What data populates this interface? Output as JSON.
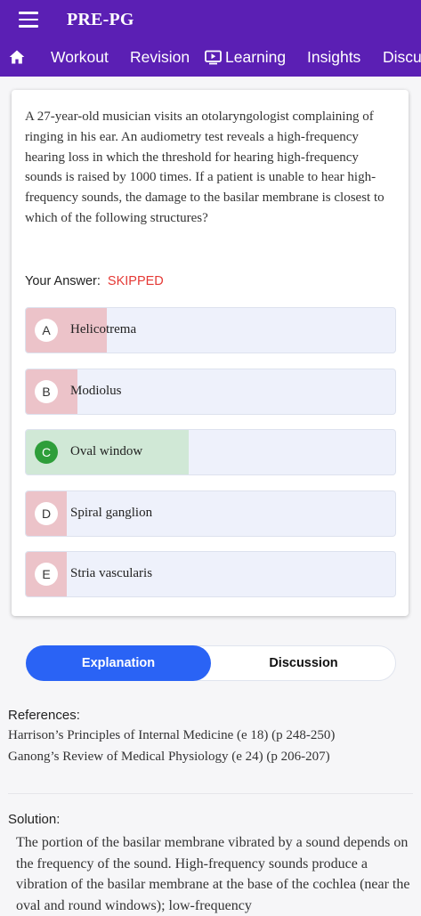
{
  "header": {
    "app_title": "PRE-PG",
    "nav_tabs": [
      {
        "label": "Workout"
      },
      {
        "label": "Revision"
      },
      {
        "label": "Learning",
        "icon": "play-screen-icon"
      },
      {
        "label": "Insights"
      },
      {
        "label": "Discu"
      }
    ],
    "colors": {
      "bar": "#5b1fb4"
    }
  },
  "question": {
    "text": "A 27-year-old musician visits an otolaryngologist complaining of ringing in his ear. An audiometry test reveals a high-frequency hearing loss in which the threshold for hearing high-frequency sounds is raised by 1000 times. If a patient is unable to hear high-frequency sounds, the damage to the basilar membrane is closest to which of the following structures?",
    "your_answer_label": "Your Answer:",
    "your_answer_value": "SKIPPED",
    "options": [
      {
        "letter": "A",
        "text": "Helicotrema",
        "share": 0.22,
        "status": "wrong"
      },
      {
        "letter": "B",
        "text": "Modiolus",
        "share": 0.14,
        "status": "wrong"
      },
      {
        "letter": "C",
        "text": "Oval window",
        "share": 0.44,
        "status": "correct"
      },
      {
        "letter": "D",
        "text": "Spiral ganglion",
        "share": 0.11,
        "status": "wrong"
      },
      {
        "letter": "E",
        "text": "Stria vascularis",
        "share": 0.11,
        "status": "wrong"
      }
    ]
  },
  "tabs": {
    "explanation": "Explanation",
    "discussion": "Discussion",
    "active": "explanation",
    "colors": {
      "active": "#2a63f5"
    }
  },
  "references": {
    "title": "References:",
    "items": [
      "Harrison’s Principles of Internal Medicine (e 18) (p 248-250)",
      "Ganong’s Review of Medical Physiology (e 24) (p 206-207)"
    ]
  },
  "solution": {
    "title": "Solution:",
    "text": "The portion of the basilar membrane vibrated by a sound depends on the frequency of the sound. High-frequency sounds produce a vibration of the basilar membrane at the base of the cochlea (near the oval and round windows); low-frequency"
  }
}
